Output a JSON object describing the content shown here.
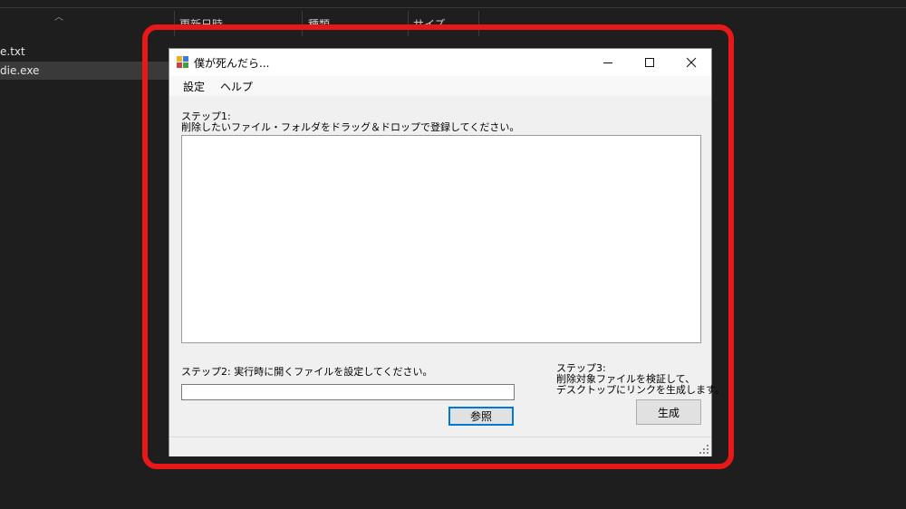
{
  "explorer": {
    "columns": [
      "更新日時",
      "種類",
      "サイズ"
    ],
    "files": [
      "e.txt",
      "die.exe"
    ]
  },
  "window": {
    "title": "僕が死んだら...",
    "menu": [
      "設定",
      "ヘルプ"
    ],
    "step1_heading": "ステップ1:",
    "step1_text": "削除したいファイル・フォルダをドラッグ＆ドロップで登録してください。",
    "step2_text": "ステップ2: 実行時に開くファイルを設定してください。",
    "step2_input_value": "",
    "browse_button": "参照",
    "step3_heading": "ステップ3:",
    "step3_line1": "削除対象ファイルを検証して、",
    "step3_line2": "デスクトップにリンクを生成します。",
    "generate_button": "生成"
  },
  "colors": {
    "highlight": "#e81818",
    "focus": "#0078d7"
  }
}
